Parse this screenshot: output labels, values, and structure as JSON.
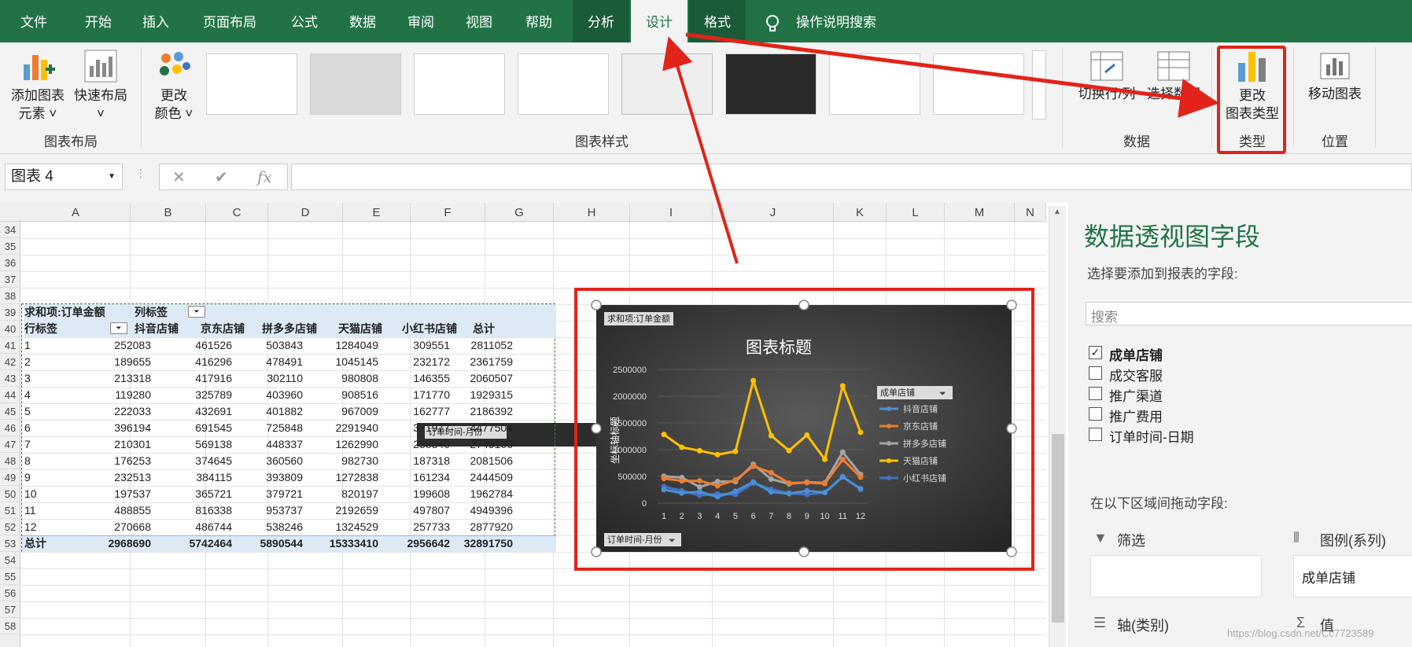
{
  "tabs": [
    "文件",
    "开始",
    "插入",
    "页面布局",
    "公式",
    "数据",
    "审阅",
    "视图",
    "帮助",
    "分析",
    "设计",
    "格式"
  ],
  "tell_me": "操作说明搜索",
  "ribbon": {
    "add_element": [
      "添加图表",
      "元素 ˅"
    ],
    "quick_layout": [
      "快速布局",
      "˅"
    ],
    "change_color": [
      "更改",
      "颜色 ˅"
    ],
    "group_layout": "图表布局",
    "group_styles": "图表样式",
    "switch_rowcol": "切换行/列",
    "select_data": "选择数据",
    "group_data": "数据",
    "change_type": [
      "更改",
      "图表类型"
    ],
    "group_type": "类型",
    "move_chart": "移动图表",
    "group_location": "位置"
  },
  "formula_bar": {
    "name_box": "图表 4",
    "fx": "fx",
    "cancel": "✕",
    "enter": "✔",
    "formula": ""
  },
  "columns": [
    "A",
    "B",
    "C",
    "D",
    "E",
    "F",
    "G",
    "H",
    "I",
    "J",
    "K",
    "L",
    "M",
    "N"
  ],
  "rows": [
    "34",
    "35",
    "36",
    "37",
    "38",
    "39",
    "40",
    "41",
    "42",
    "43",
    "44",
    "45",
    "46",
    "47",
    "48",
    "49",
    "50",
    "51",
    "52",
    "53",
    "54",
    "55",
    "56",
    "57",
    "58"
  ],
  "pivot": {
    "value_label": "求和项:订单金额",
    "col_label": "列标签",
    "row_label": "行标签",
    "headers": [
      "抖音店铺",
      "京东店铺",
      "拼多多店铺",
      "天猫店铺",
      "小红书店铺",
      "总计"
    ],
    "data": [
      [
        "1",
        "252083",
        "461526",
        "503843",
        "1284049",
        "309551",
        "2811052"
      ],
      [
        "2",
        "189655",
        "416296",
        "478491",
        "1045145",
        "232172",
        "2361759"
      ],
      [
        "3",
        "213318",
        "417916",
        "302110",
        "980808",
        "146355",
        "2060507"
      ],
      [
        "4",
        "119280",
        "325789",
        "403960",
        "908516",
        "171770",
        "1929315"
      ],
      [
        "5",
        "222033",
        "432691",
        "401882",
        "967009",
        "162777",
        "2186392"
      ],
      [
        "6",
        "396194",
        "691545",
        "725848",
        "2291940",
        "371977",
        "4477504"
      ],
      [
        "7",
        "210301",
        "569138",
        "448337",
        "1262990",
        "258340",
        "2749106"
      ],
      [
        "8",
        "176253",
        "374645",
        "360560",
        "982730",
        "187318",
        "2081506"
      ],
      [
        "9",
        "232513",
        "384115",
        "393809",
        "1272838",
        "161234",
        "2444509"
      ],
      [
        "10",
        "197537",
        "365721",
        "379721",
        "820197",
        "199608",
        "1962784"
      ],
      [
        "11",
        "488855",
        "816338",
        "953737",
        "2192659",
        "497807",
        "4949396"
      ],
      [
        "12",
        "270668",
        "486744",
        "538246",
        "1324529",
        "257733",
        "2877920"
      ]
    ],
    "total": [
      "总计",
      "2968690",
      "5742464",
      "5890544",
      "15333410",
      "2956642",
      "32891750"
    ]
  },
  "top_chart_field": "订单时间-月份",
  "chart_data": {
    "type": "line",
    "title": "图表标题",
    "ylabel": "坐标轴标题",
    "value_field": "求和项:订单金额",
    "axis_field": "订单时间-月份",
    "legend_title": "成单店铺",
    "legend_position": "right",
    "categories": [
      "1",
      "2",
      "3",
      "4",
      "5",
      "6",
      "7",
      "8",
      "9",
      "10",
      "11",
      "12"
    ],
    "yticks": [
      "2500000",
      "2000000",
      "1500000",
      "1000000",
      "500000",
      "0"
    ],
    "ylim": [
      0,
      2500000
    ],
    "series": [
      {
        "name": "抖音店铺",
        "color": "#4a8fd6",
        "values": [
          252083,
          189655,
          213318,
          119280,
          222033,
          396194,
          210301,
          176253,
          232513,
          197537,
          488855,
          270668
        ]
      },
      {
        "name": "京东店铺",
        "color": "#ed7d31",
        "values": [
          461526,
          416296,
          417916,
          325789,
          432691,
          691545,
          569138,
          374645,
          384115,
          365721,
          816338,
          486744
        ]
      },
      {
        "name": "拼多多店铺",
        "color": "#a5a5a5",
        "values": [
          503843,
          478491,
          302110,
          403960,
          401882,
          725848,
          448337,
          360560,
          393809,
          379721,
          953737,
          538246
        ]
      },
      {
        "name": "天猫店铺",
        "color": "#ffc000",
        "values": [
          1284049,
          1045145,
          980808,
          908516,
          967009,
          2291940,
          1262990,
          982730,
          1272838,
          820197,
          2192659,
          1324529
        ]
      },
      {
        "name": "小红书店铺",
        "color": "#4472c4",
        "values": [
          309551,
          232172,
          146355,
          171770,
          162777,
          371977,
          258340,
          187318,
          161234,
          199608,
          497807,
          257733
        ]
      }
    ]
  },
  "field_panel": {
    "title": "数据透视图字段",
    "subtitle": "选择要添加到报表的字段:",
    "search_placeholder": "搜索",
    "fields": [
      {
        "name": "成单店铺",
        "checked": true
      },
      {
        "name": "成交客服",
        "checked": false
      },
      {
        "name": "推广渠道",
        "checked": false
      },
      {
        "name": "推广费用",
        "checked": false
      },
      {
        "name": "订单时间-日期",
        "checked": false
      }
    ],
    "drag_hint": "在以下区域间拖动字段:",
    "filter_label": "筛选",
    "legend_label": "图例(系列)",
    "legend_value": "成单店铺",
    "axis_label": "轴(类别)",
    "values_label": "值"
  },
  "watermark": "https://blog.csdn.net/Cc7723589"
}
